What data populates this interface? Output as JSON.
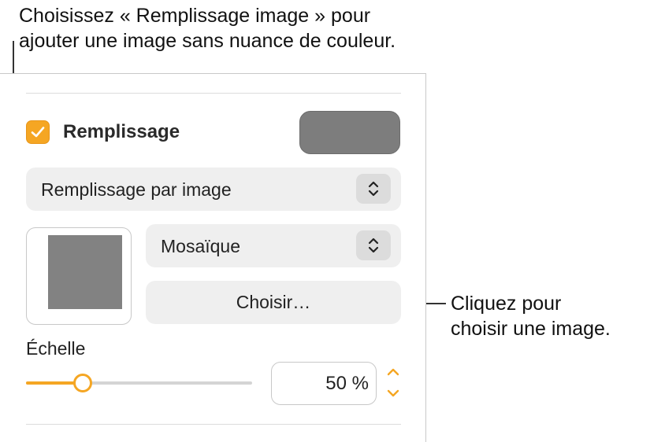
{
  "callouts": {
    "top": "Choisissez « Remplissage image » pour\najouter une image sans nuance de couleur.",
    "right": "Cliquez pour\nchoisir une image."
  },
  "fill": {
    "label": "Remplissage",
    "checked": true,
    "fill_type_value": "Remplissage par image",
    "scale_mode_value": "Mosaïque",
    "choose_label": "Choisir…"
  },
  "scale": {
    "label": "Échelle",
    "value_text": "50 %",
    "fraction": 0.25
  },
  "colors": {
    "accent": "#f5a623",
    "swatch": "#7d7d7d"
  },
  "icons": {
    "checkbox": "checkmark-icon",
    "popup": "up-down-chevron-icon",
    "stepper_up": "chevron-up-icon",
    "stepper_down": "chevron-down-icon"
  }
}
